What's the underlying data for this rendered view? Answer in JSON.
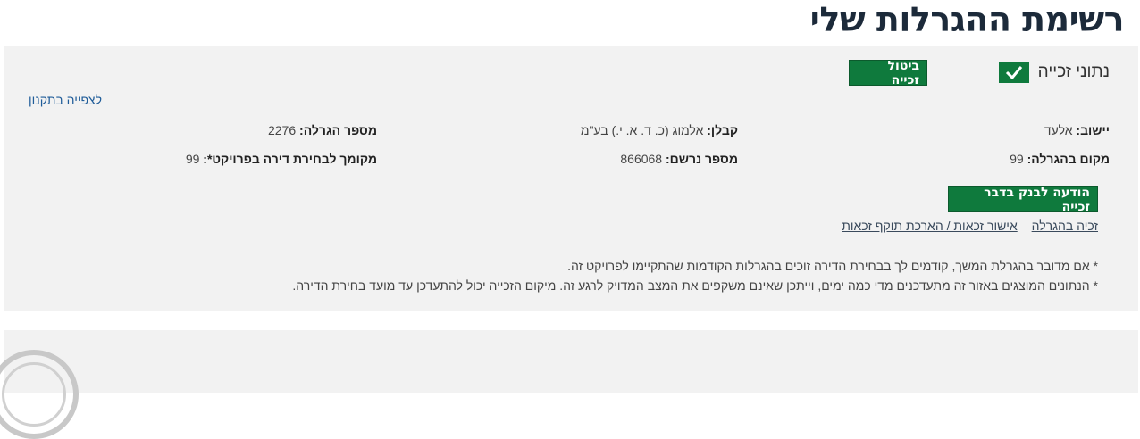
{
  "page": {
    "title": "רשימת ההגרלות שלי"
  },
  "lottery": {
    "win_status_label": "נתוני זכייה",
    "cancel_button": "ביטול זכייה",
    "view_regulations_link": "לצפייה בתקנון",
    "fields": {
      "settlement_label": "יישוב:",
      "settlement_value": " אלעד",
      "contractor_label": "קבלן:",
      "contractor_value": " אלמוג (כ. ד. א. י.) בע\"מ",
      "lottery_number_label": "מספר הגרלה:",
      "lottery_number_value": " 2276",
      "lottery_position_label": "מקום בהגרלה:",
      "lottery_position_value": " 99",
      "registration_label": "מספר נרשם:",
      "registration_value": " 866068",
      "apartment_choice_label": "מקומך לבחירת דירה בפרויקט*:",
      "apartment_choice_value": " 99"
    },
    "notify_bank_button": "הודעה לבנק בדבר זכייה",
    "links": {
      "win_in_lottery": "זכיה בהגרלה",
      "eligibility_link": "אישור זכאות / הארכת תוקף זכאות"
    },
    "notes": [
      "* אם מדובר בהגרלת המשך, קודמים לך בבחירת הדירה זוכים בהגרלות הקודמות שהתקיימו לפרויקט זה.",
      "* הנתונים המוצגים באזור זה מתעדכנים מדי כמה ימים, וייתכן שאינם משקפים את המצב המדויק לרגע זה. מיקום הזכייה יכול להתעדכן עד מועד בחירת הדירה."
    ]
  },
  "colors": {
    "accent_green": "#0f7a3d",
    "title": "#1c2a3a",
    "card_bg": "#f2f2f2"
  }
}
